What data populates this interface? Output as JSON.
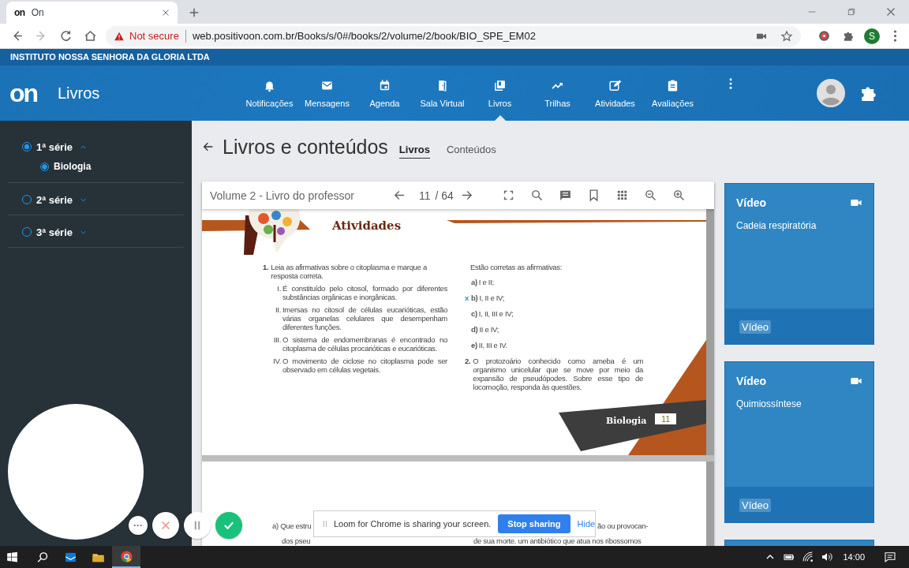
{
  "browser": {
    "favicon": "on",
    "tab_title": "On",
    "security": "Not secure",
    "url": "web.positivoon.com.br/Books/s/0#/books/2/volume/2/book/BIO_SPE_EM02",
    "profile_initial": "S"
  },
  "app": {
    "institution": "INSTITUTO NOSSA SENHORA DA GLORIA LTDA",
    "logo": "on",
    "section": "Livros",
    "nav": [
      {
        "label": "Notificações",
        "selected": false
      },
      {
        "label": "Mensagens",
        "selected": false
      },
      {
        "label": "Agenda",
        "selected": false
      },
      {
        "label": "Sala Virtual",
        "selected": false
      },
      {
        "label": "Livros",
        "selected": true
      },
      {
        "label": "Trilhas",
        "selected": false
      },
      {
        "label": "Atividades",
        "selected": false
      },
      {
        "label": "Avaliações",
        "selected": false
      }
    ]
  },
  "sidebar": {
    "series": [
      {
        "label": "1ª série",
        "selected": true,
        "expanded": true,
        "children": [
          {
            "label": "Biologia",
            "selected": true
          }
        ]
      },
      {
        "label": "2ª série",
        "selected": false,
        "expanded": false
      },
      {
        "label": "3ª série",
        "selected": false,
        "expanded": false
      }
    ]
  },
  "main": {
    "title": "Livros e conteúdos",
    "tabs": [
      {
        "label": "Livros",
        "selected": true
      },
      {
        "label": "Conteúdos",
        "selected": false
      }
    ]
  },
  "viewer": {
    "title": "Volume 2 - Livro do professor",
    "page": "11",
    "total": "/ 64"
  },
  "book_page": {
    "heading": "Atividades",
    "question_1": {
      "number": "1.",
      "text": "Leia as afirmativas sobre o citoplasma e marque a resposta correta.",
      "statements": [
        {
          "numeral": "I.",
          "text": "É constituído pelo citosol, formado por diferentes substâncias orgânicas e inorgânicas."
        },
        {
          "numeral": "II.",
          "text": "Imersas no citosol de células eucarióticas, estão várias organelas celulares que desempenham diferentes funções."
        },
        {
          "numeral": "III.",
          "text": "O sistema de endomembranas é encontrado no citoplasma de células procarióticas e eucarióticas."
        },
        {
          "numeral": "IV.",
          "text": "O movimento de ciclose no citoplasma pode ser observado em células vegetais."
        }
      ],
      "prompt": "Estão corretas as afirmativas:",
      "options": [
        {
          "letter": "a)",
          "text": "I e II;"
        },
        {
          "marker": "x",
          "letter": "b)",
          "text": "I, II e IV;"
        },
        {
          "letter": "c)",
          "text": "I, II, III e IV;"
        },
        {
          "letter": "d)",
          "text": "II e IV;"
        },
        {
          "letter": "e)",
          "text": "II, III e IV."
        }
      ]
    },
    "question_2": {
      "number": "2.",
      "text": "O protozoário conhecido como ameba é um organismo unicelular que se move por meio da expansão de pseudópodes. Sobre esse tipo de locomoção, responda às questões."
    },
    "subject": "Biologia",
    "page_number": "11"
  },
  "next_page": {
    "left_lines": [
      "a) Que estru",
      "dos pseu"
    ],
    "right_lines": [
      "ão ou provocan-",
      "de sua morte. um antibiótico que atua nos ribossomos"
    ]
  },
  "cards": [
    {
      "kind": "video",
      "title": "Vídeo",
      "subtitle": "Cadeia respiratória",
      "tag": "Vídeo"
    },
    {
      "kind": "video",
      "title": "Vídeo",
      "subtitle": "Quimiossíntese",
      "tag": "Vídeo"
    },
    {
      "kind": "partial"
    }
  ],
  "loom": {
    "message": "Loom for Chrome is sharing your screen.",
    "stop": "Stop sharing",
    "hide": "Hide",
    "more": "···"
  },
  "taskbar": {
    "time": "14:00"
  }
}
